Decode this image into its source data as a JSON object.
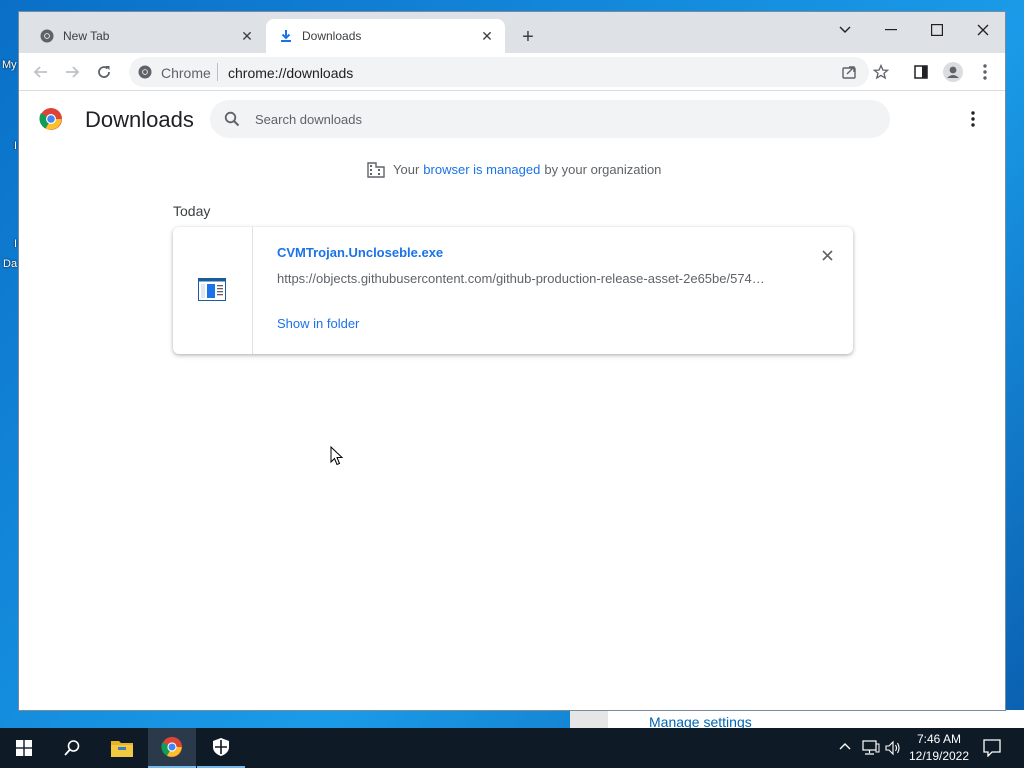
{
  "browser": {
    "tabs": [
      {
        "title": "New Tab",
        "icon": "chrome-icon",
        "active": false
      },
      {
        "title": "Downloads",
        "icon": "download-icon",
        "active": true
      }
    ],
    "omnibox": {
      "site_label": "Chrome",
      "url": "chrome://downloads"
    }
  },
  "downloads_page": {
    "title": "Downloads",
    "search_placeholder": "Search downloads",
    "managed_notice": {
      "prefix": "Your",
      "link": "browser is managed",
      "suffix": "by your organization"
    },
    "groups": [
      {
        "label": "Today",
        "items": [
          {
            "filename": "CVMTrojan.Uncloseble.exe",
            "url": "https://objects.githubusercontent.com/github-production-release-asset-2e65be/574…",
            "action_label": "Show in folder"
          }
        ]
      }
    ]
  },
  "desktop": {
    "fragments": [
      "My",
      "Da"
    ],
    "notification_link": "Manage settings"
  },
  "taskbar": {
    "time": "7:46 AM",
    "date": "12/19/2022"
  },
  "colors": {
    "link": "#1a73e8",
    "tabstrip": "#dee1e6",
    "taskbar": "#0e1a26"
  }
}
